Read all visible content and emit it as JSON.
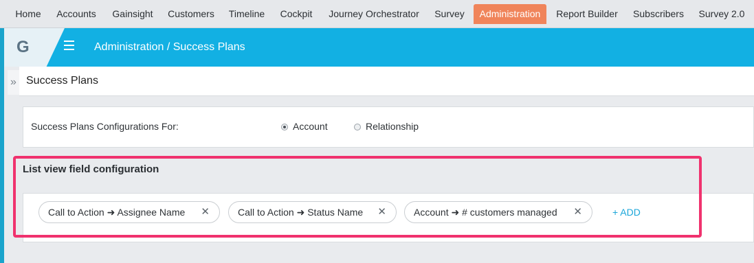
{
  "nav_tabs": [
    {
      "label": "Home"
    },
    {
      "label": "Accounts"
    },
    {
      "label": "Gainsight"
    },
    {
      "label": "Customers"
    },
    {
      "label": "Timeline"
    },
    {
      "label": "Cockpit"
    },
    {
      "label": "Journey Orchestrator"
    },
    {
      "label": "Survey"
    },
    {
      "label": "Administration",
      "active": true
    },
    {
      "label": "Report Builder"
    },
    {
      "label": "Subscribers"
    },
    {
      "label": "Survey 2.0"
    }
  ],
  "header": {
    "logo_letter": "G",
    "breadcrumb": "Administration / Success Plans",
    "accent_color": "#12b0e3"
  },
  "page": {
    "title": "Success Plans",
    "collapse_glyph": "»"
  },
  "config": {
    "label": "Success Plans Configurations For:",
    "options": [
      {
        "label": "Account",
        "selected": true
      },
      {
        "label": "Relationship",
        "selected": false
      }
    ]
  },
  "list_view": {
    "title": "List view field configuration",
    "fields": [
      {
        "label": "Call to Action ➜ Assignee Name"
      },
      {
        "label": "Call to Action ➜ Status Name"
      },
      {
        "label": "Account ➜ # customers managed"
      }
    ],
    "remove_glyph": "✕",
    "add_label": "+ ADD",
    "highlight_color": "#f0326e"
  }
}
